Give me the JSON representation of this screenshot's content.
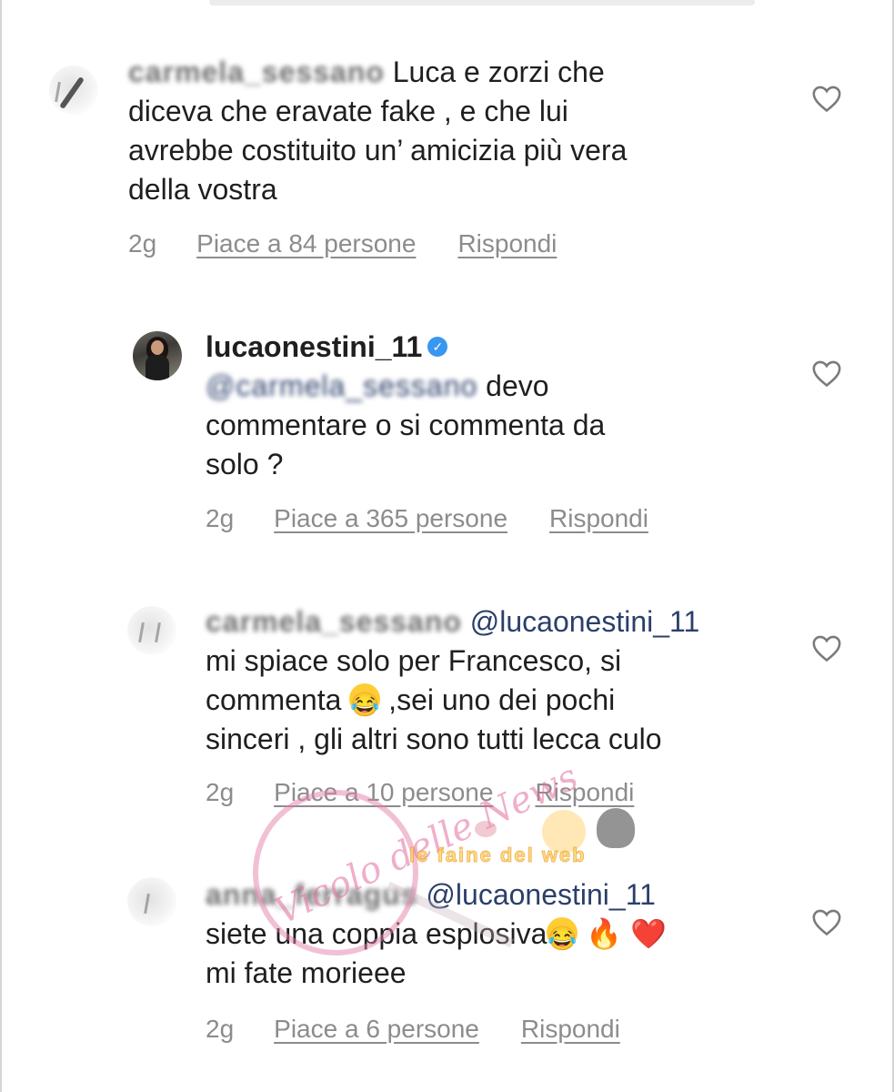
{
  "comments": [
    {
      "username_blurred": "carmela_sessano",
      "text": "Luca e zorzi che diceva che eravate fake , e che lui avrebbe costituito un’ amicizia più vera della vostra",
      "lines": [
        "Luca e zorzi che",
        "diceva che eravate fake , e che lui",
        "avrebbe costituito un’ amicizia più vera",
        "della vostra"
      ],
      "time": "2g",
      "likes": "Piace a 84 persone",
      "reply": "Rispondi"
    },
    {
      "username": "lucaonestini_11",
      "verified": true,
      "mention_blurred": "@carmela_sessano",
      "lines": [
        "devo",
        "commentare o si commenta da",
        "solo ?"
      ],
      "time": "2g",
      "likes": "Piace a 365 persone",
      "reply": "Rispondi"
    },
    {
      "username_blurred": "carmela_sessano",
      "mention": "@lucaonestini_11",
      "lines": [
        "mi spiace solo per Francesco, si",
        "commenta",
        ",sei uno dei pochi",
        "sinceri , gli altri sono tutti lecca culo"
      ],
      "time": "2g",
      "likes": "Piace a 10 persone",
      "reply": "Rispondi"
    },
    {
      "username_blurred": "anna_ferragus",
      "mention": "@lucaonestini_11",
      "lines": [
        "siete una coppia esplosiva",
        "mi fate morieee"
      ],
      "emojis": [
        "😂",
        "🔥",
        "❤️"
      ],
      "time": "2g",
      "likes": "Piace a 6 persone",
      "reply": "Rispondi"
    }
  ],
  "watermarks": {
    "left": "Vicolo delle News",
    "right": "le faine del web"
  },
  "icons": {
    "like": "heart-outline-icon",
    "verified": "verified-badge-icon"
  },
  "colors": {
    "text": "#1f1f1f",
    "meta": "#8c8c8c",
    "verified": "#3897f0",
    "mention": "#2b3f6b"
  }
}
